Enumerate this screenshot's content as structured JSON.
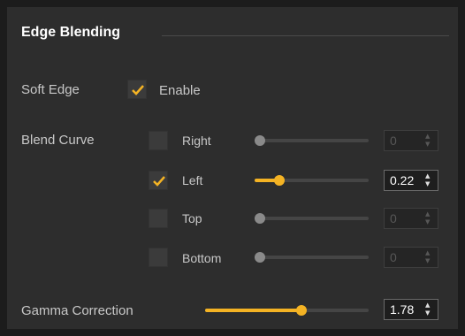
{
  "header": {
    "title": "Edge Blending"
  },
  "soft_edge": {
    "label": "Soft Edge",
    "checked": true,
    "option_label": "Enable"
  },
  "blend_curve": {
    "label": "Blend Curve",
    "edges": [
      {
        "label": "Right",
        "checked": false,
        "level": 0.0,
        "value": "0",
        "enabled": false
      },
      {
        "label": "Left",
        "checked": true,
        "level": 0.22,
        "value": "0.22",
        "enabled": true
      },
      {
        "label": "Top",
        "checked": false,
        "level": 0.0,
        "value": "0",
        "enabled": false
      },
      {
        "label": "Bottom",
        "checked": false,
        "level": 0.0,
        "value": "0",
        "enabled": false
      }
    ]
  },
  "gamma": {
    "label": "Gamma Correction",
    "level": 0.59,
    "value": "1.78",
    "enabled": true
  },
  "icons": {
    "check": "checkmark-icon",
    "spin_up": "chevron-up-icon",
    "spin_down": "chevron-down-icon"
  },
  "colors": {
    "accent": "#f4b324",
    "panel": "#2d2d2d",
    "background": "#1c1c1c"
  }
}
